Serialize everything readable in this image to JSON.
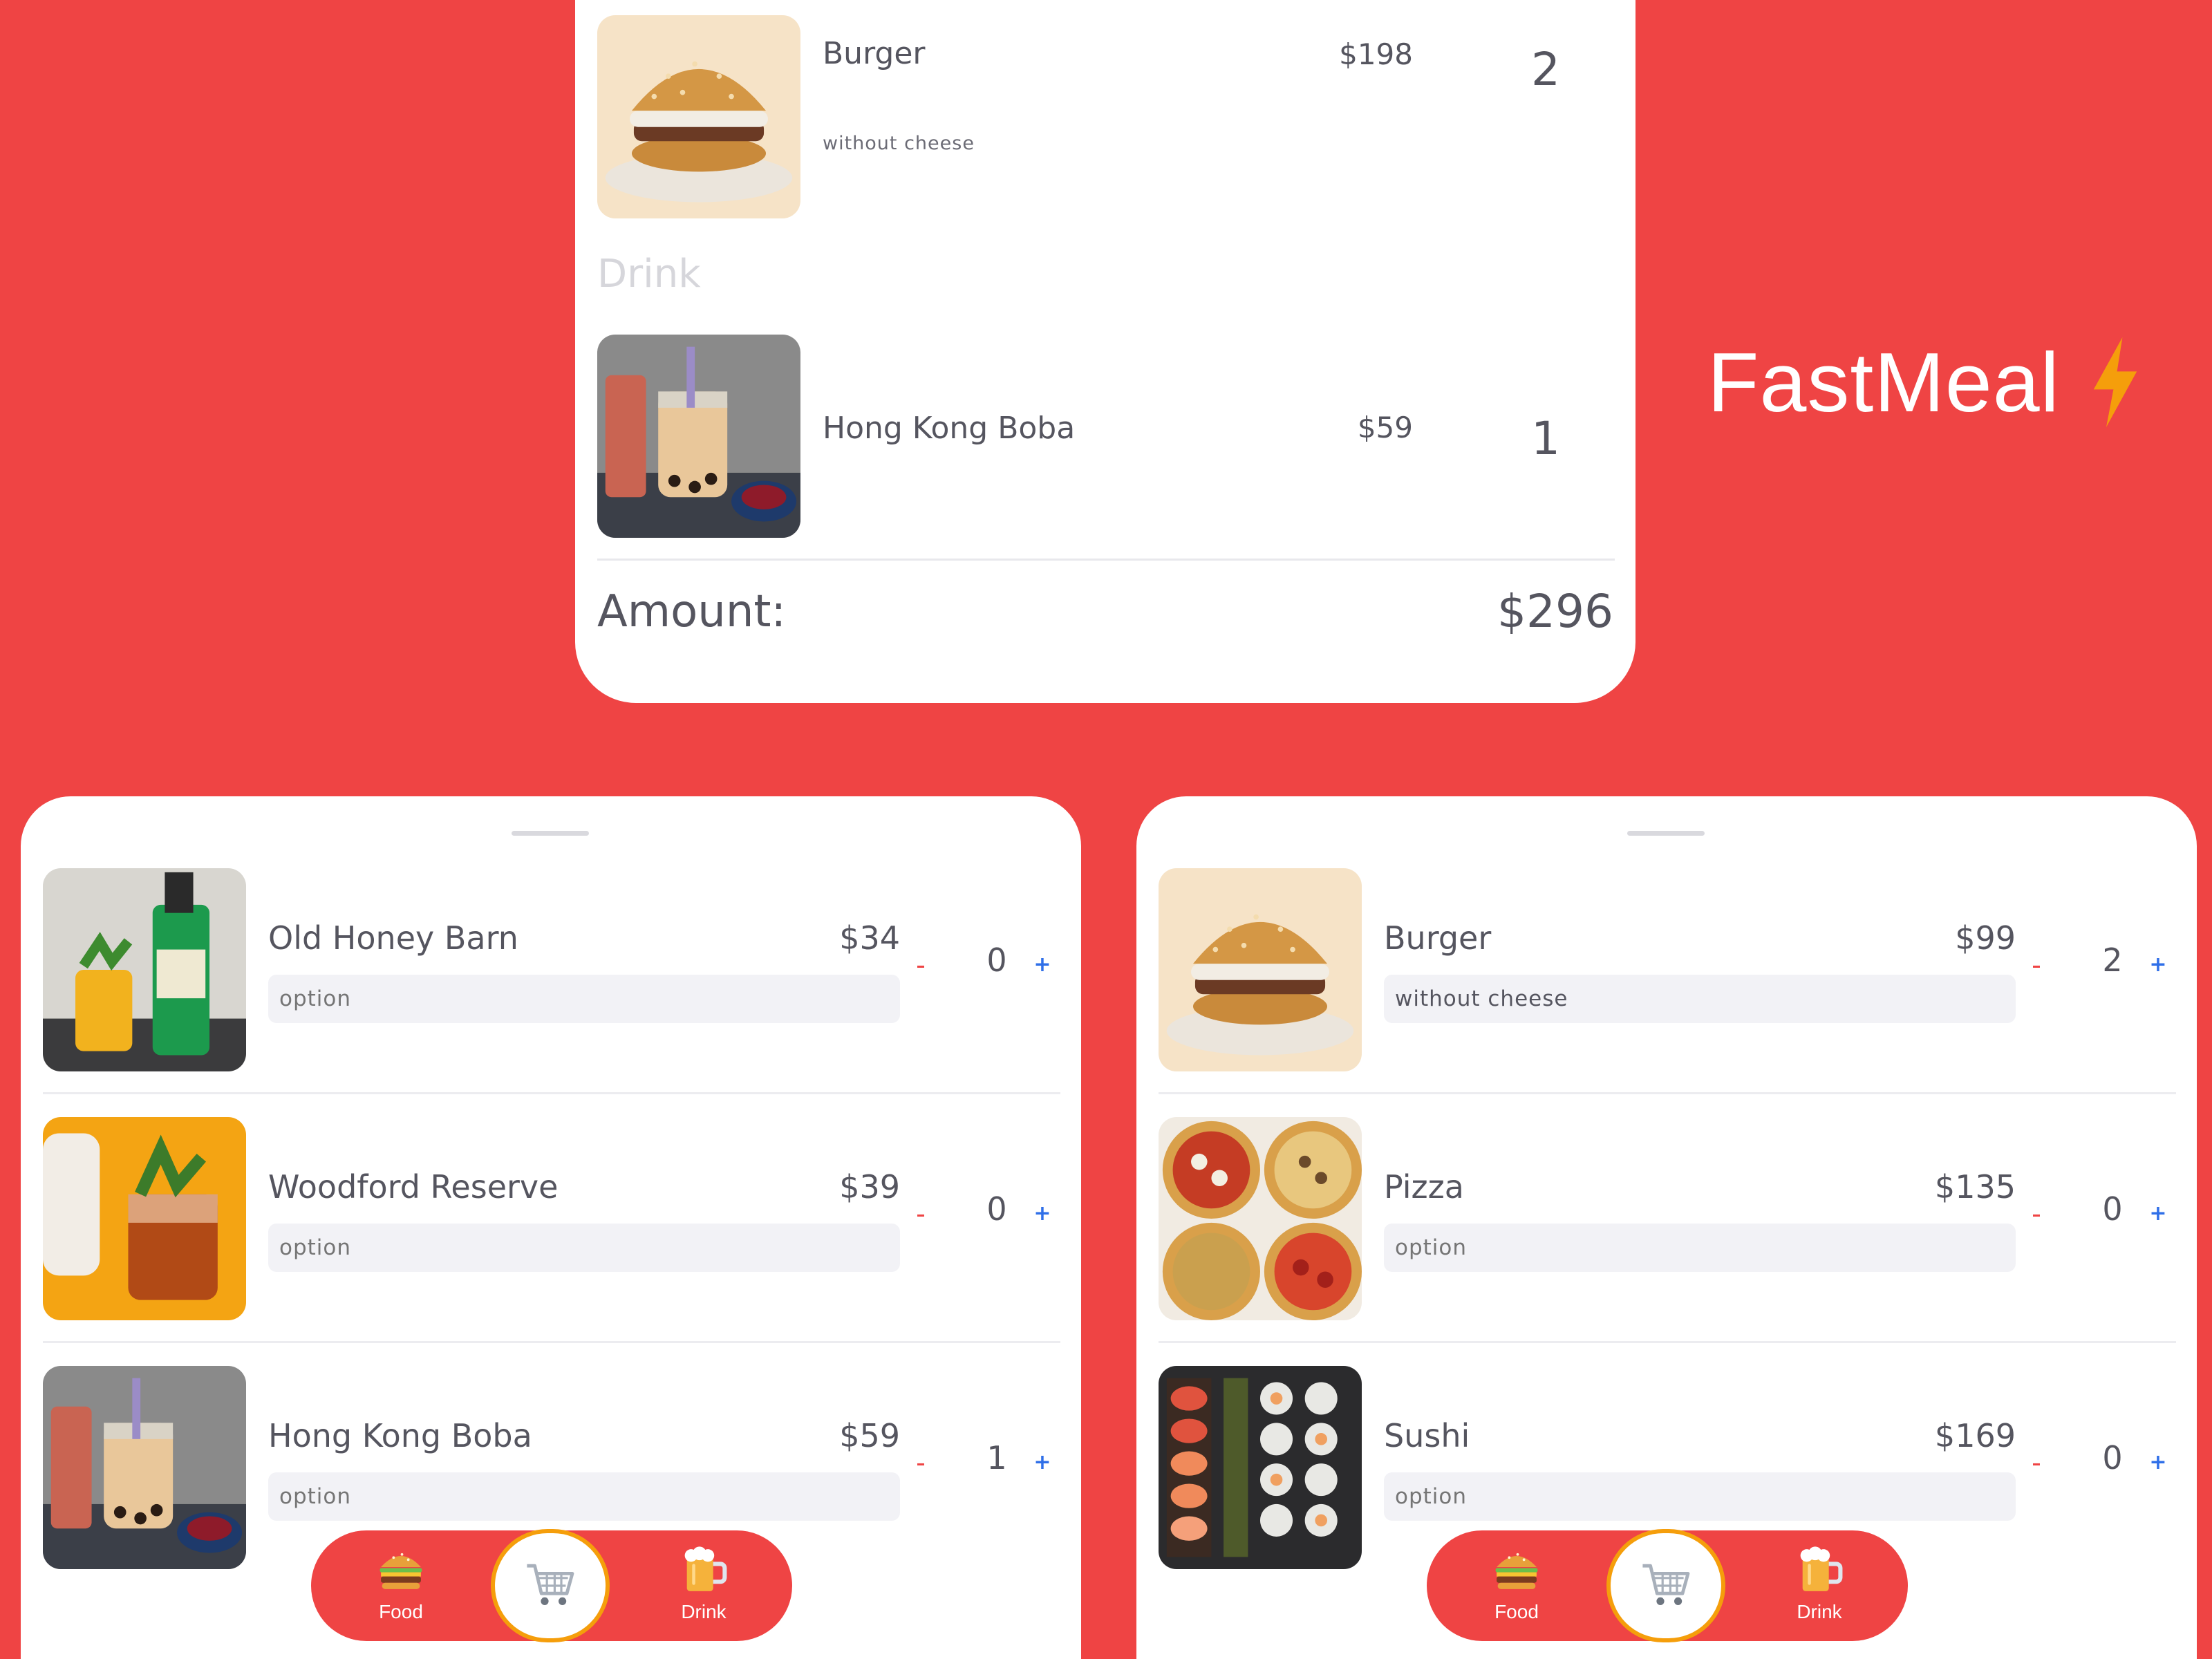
{
  "brand": {
    "name": "FastMeal",
    "icon": "lightning-bolt-icon",
    "accent": "#f59e0b"
  },
  "colors": {
    "background": "#ef4444",
    "plus": "#2f6fe8",
    "minus": "#ef4444"
  },
  "summary": {
    "items": [
      {
        "name": "Burger",
        "note": "without cheese",
        "price": "$198",
        "qty": "2",
        "image": "burger-photo"
      }
    ],
    "drink_section": "Drink",
    "drink_items": [
      {
        "name": "Hong Kong Boba",
        "price": "$59",
        "qty": "1",
        "image": "boba-photo"
      }
    ],
    "amount_label": "Amount:",
    "amount_value": "$296"
  },
  "drink_panel": {
    "items": [
      {
        "name": "Old Honey Barn",
        "price": "$34",
        "option_placeholder": "option",
        "option_value": "",
        "qty": "0",
        "minus": "-",
        "plus": "+"
      },
      {
        "name": "Woodford Reserve",
        "price": "$39",
        "option_placeholder": "option",
        "option_value": "",
        "qty": "0",
        "minus": "-",
        "plus": "+"
      },
      {
        "name": "Hong Kong Boba",
        "price": "$59",
        "option_placeholder": "option",
        "option_value": "",
        "qty": "1",
        "minus": "-",
        "plus": "+"
      }
    ]
  },
  "food_panel": {
    "items": [
      {
        "name": "Burger",
        "price": "$99",
        "option_placeholder": "option",
        "option_value": "without cheese",
        "qty": "2",
        "minus": "-",
        "plus": "+"
      },
      {
        "name": "Pizza",
        "price": "$135",
        "option_placeholder": "option",
        "option_value": "",
        "qty": "0",
        "minus": "-",
        "plus": "+"
      },
      {
        "name": "Sushi",
        "price": "$169",
        "option_placeholder": "option",
        "option_value": "",
        "qty": "0",
        "minus": "-",
        "plus": "+"
      }
    ]
  },
  "nav": {
    "food_label": "Food",
    "drink_label": "Drink",
    "food_icon": "burger-icon",
    "cart_icon": "cart-icon",
    "drink_icon": "beer-mug-icon"
  }
}
